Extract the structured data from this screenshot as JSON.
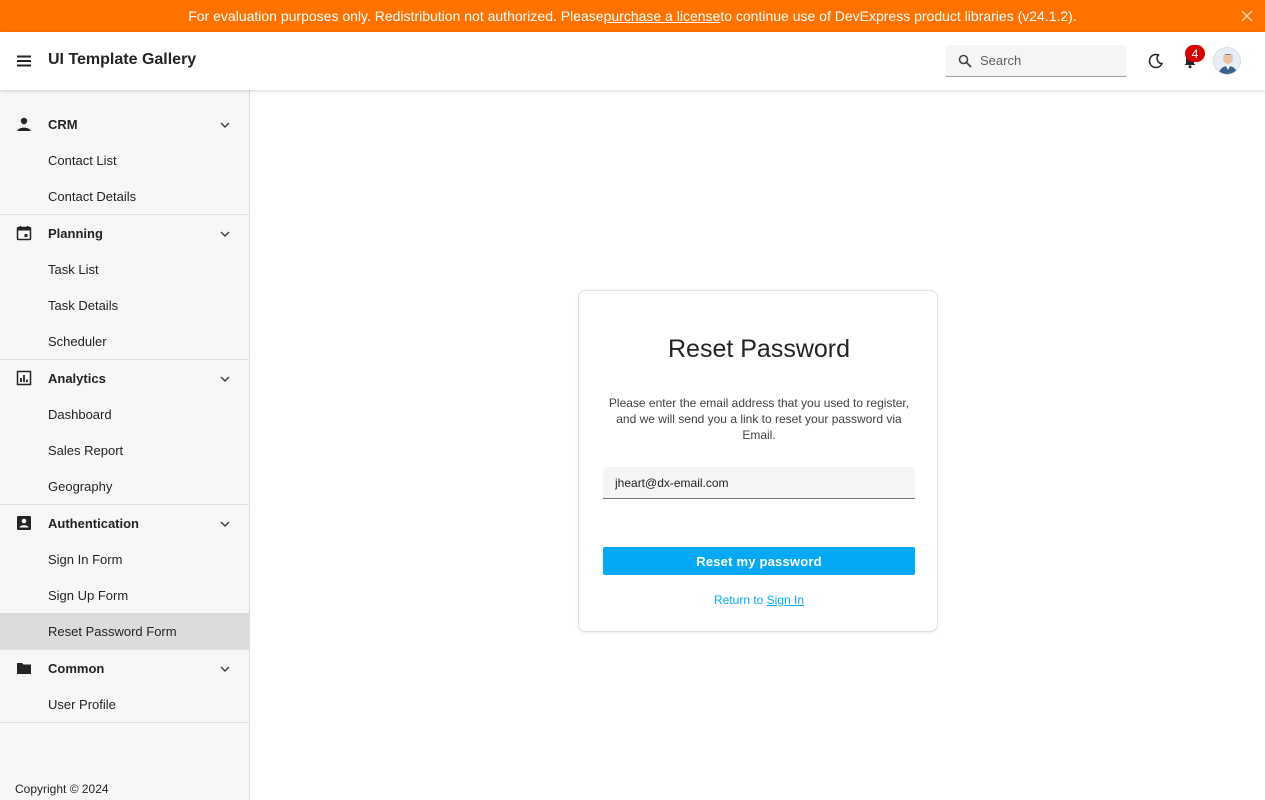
{
  "banner": {
    "text_before": "For evaluation purposes only. Redistribution not authorized. Please ",
    "link_text": "purchase a license",
    "text_after": " to continue use of DevExpress product libraries (v24.1.2).",
    "color": "#ff7200"
  },
  "header": {
    "title": "UI Template Gallery",
    "search_placeholder": "Search",
    "notification_count": "4"
  },
  "sidebar": {
    "groups": [
      {
        "label": "CRM",
        "icon": "person-icon",
        "items": [
          "Contact List",
          "Contact Details"
        ]
      },
      {
        "label": "Planning",
        "icon": "calendar-icon",
        "items": [
          "Task List",
          "Task Details",
          "Scheduler"
        ]
      },
      {
        "label": "Analytics",
        "icon": "chart-icon",
        "items": [
          "Dashboard",
          "Sales Report",
          "Geography"
        ]
      },
      {
        "label": "Authentication",
        "icon": "contact-card-icon",
        "items": [
          "Sign In Form",
          "Sign Up Form",
          "Reset Password Form"
        ]
      },
      {
        "label": "Common",
        "icon": "folder-icon",
        "items": [
          "User Profile"
        ]
      }
    ],
    "active_item": "Reset Password Form",
    "footer": "Copyright © 2024"
  },
  "card": {
    "title": "Reset Password",
    "description": "Please enter the email address that you used to register, and we will send you a link to reset your password via Email.",
    "email_value": "jheart@dx-email.com",
    "button_label": "Reset my password",
    "return_text": "Return to ",
    "return_link": "Sign In",
    "accent": "#03a9f4"
  }
}
